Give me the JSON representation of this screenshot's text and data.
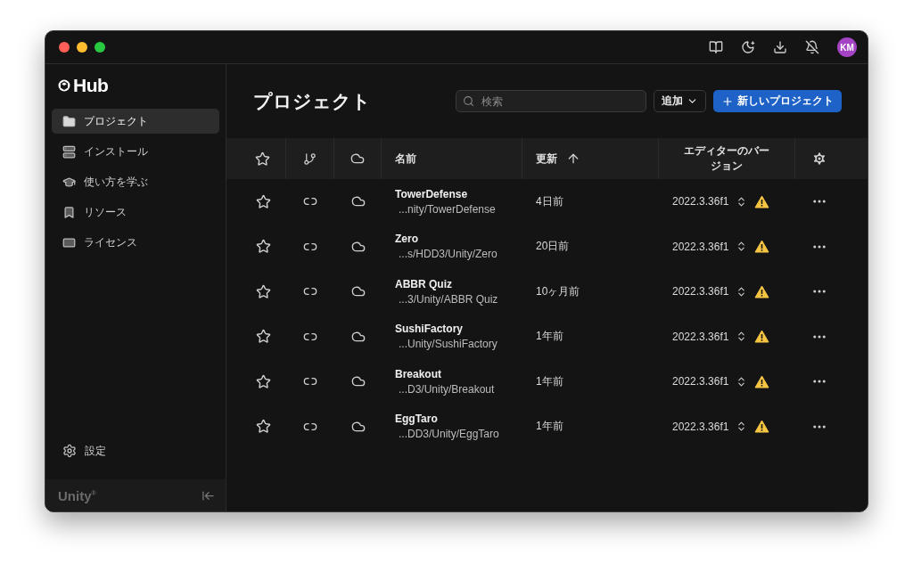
{
  "titlebar": {
    "avatar": "KM"
  },
  "sidebar": {
    "logo": "Hub",
    "items": [
      {
        "label": "プロジェクト",
        "selected": true
      },
      {
        "label": "インストール",
        "selected": false
      },
      {
        "label": "使い方を学ぶ",
        "selected": false
      },
      {
        "label": "リソース",
        "selected": false
      },
      {
        "label": "ライセンス",
        "selected": false
      }
    ],
    "settings": "設定",
    "brand": "Unity$^{®}$"
  },
  "main": {
    "title": "プロジェクト",
    "search": {
      "placeholder": "検索"
    },
    "add_button": "追加",
    "new_button": "新しいプロジェクト"
  },
  "table": {
    "columns": {
      "name": "名前",
      "updated": "更新",
      "version": "エディターのバージョン"
    },
    "rows": [
      {
        "name": "TowerDefense",
        "path": "...nity/TowerDefense",
        "updated": "4日前",
        "version": "2022.3.36f1",
        "favorite": false,
        "warning": true
      },
      {
        "name": "Zero",
        "path": "...s/HDD3/Unity/Zero",
        "updated": "20日前",
        "version": "2022.3.36f1",
        "favorite": false,
        "warning": true
      },
      {
        "name": "ABBR Quiz",
        "path": "...3/Unity/ABBR Quiz",
        "updated": "10ヶ月前",
        "version": "2022.3.36f1",
        "favorite": false,
        "warning": true
      },
      {
        "name": "SushiFactory",
        "path": "...Unity/SushiFactory",
        "updated": "1年前",
        "version": "2022.3.36f1",
        "favorite": false,
        "warning": true
      },
      {
        "name": "Breakout",
        "path": "...D3/Unity/Breakout",
        "updated": "1年前",
        "version": "2022.3.36f1",
        "favorite": false,
        "warning": true
      },
      {
        "name": "EggTaro",
        "path": "...DD3/Unity/EggTaro",
        "updated": "1年前",
        "version": "2022.3.36f1",
        "favorite": false,
        "warning": true
      }
    ]
  }
}
